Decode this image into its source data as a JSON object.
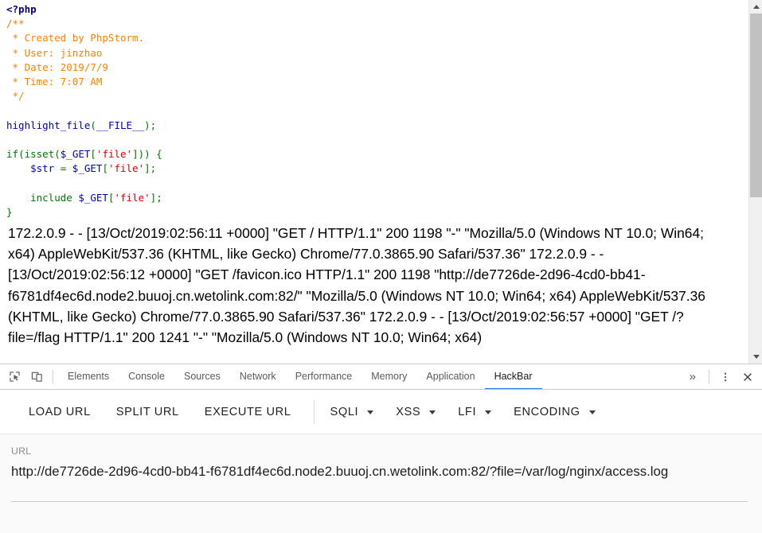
{
  "page": {
    "php_source_lines": [
      [
        {
          "t": "<?php",
          "c": "php-tag"
        }
      ],
      [
        {
          "t": "/**",
          "c": "comment"
        }
      ],
      [
        {
          "t": " * Created by PhpStorm.",
          "c": "comment"
        }
      ],
      [
        {
          "t": " * User: jinzhao",
          "c": "comment"
        }
      ],
      [
        {
          "t": " * Date: 2019/7/9",
          "c": "comment"
        }
      ],
      [
        {
          "t": " * Time: 7:07 AM",
          "c": "comment"
        }
      ],
      [
        {
          "t": " */",
          "c": "comment"
        }
      ],
      [
        {
          "t": "",
          "c": "plain"
        }
      ],
      [
        {
          "t": "highlight_file",
          "c": "fn"
        },
        {
          "t": "(",
          "c": "kw"
        },
        {
          "t": "__FILE__",
          "c": "fn"
        },
        {
          "t": ")",
          "c": "kw"
        },
        {
          "t": ";",
          "c": "punct"
        }
      ],
      [
        {
          "t": "",
          "c": "plain"
        }
      ],
      [
        {
          "t": "if",
          "c": "kw"
        },
        {
          "t": "(",
          "c": "kw"
        },
        {
          "t": "isset",
          "c": "kw"
        },
        {
          "t": "(",
          "c": "kw"
        },
        {
          "t": "$_GET",
          "c": "var"
        },
        {
          "t": "[",
          "c": "kw"
        },
        {
          "t": "'file'",
          "c": "str"
        },
        {
          "t": "]))",
          "c": "kw"
        },
        {
          "t": " {",
          "c": "kw"
        }
      ],
      [
        {
          "t": "    ",
          "c": "plain"
        },
        {
          "t": "$str",
          "c": "var"
        },
        {
          "t": " = ",
          "c": "kw"
        },
        {
          "t": "$_GET",
          "c": "var"
        },
        {
          "t": "[",
          "c": "kw"
        },
        {
          "t": "'file'",
          "c": "str"
        },
        {
          "t": "]",
          "c": "kw"
        },
        {
          "t": ";",
          "c": "punct"
        }
      ],
      [
        {
          "t": "",
          "c": "plain"
        }
      ],
      [
        {
          "t": "    ",
          "c": "plain"
        },
        {
          "t": "include",
          "c": "kw"
        },
        {
          "t": " ",
          "c": "plain"
        },
        {
          "t": "$_GET",
          "c": "var"
        },
        {
          "t": "[",
          "c": "kw"
        },
        {
          "t": "'file'",
          "c": "str"
        },
        {
          "t": "]",
          "c": "kw"
        },
        {
          "t": ";",
          "c": "punct"
        }
      ],
      [
        {
          "t": "}",
          "c": "kw"
        }
      ]
    ],
    "access_log_text": "172.2.0.9 - - [13/Oct/2019:02:56:11 +0000] \"GET / HTTP/1.1\" 200 1198 \"-\" \"Mozilla/5.0 (Windows NT 10.0; Win64; x64) AppleWebKit/537.36 (KHTML, like Gecko) Chrome/77.0.3865.90 Safari/537.36\" 172.2.0.9 - - [13/Oct/2019:02:56:12 +0000] \"GET /favicon.ico HTTP/1.1\" 200 1198 \"http://de7726de-2d96-4cd0-bb41-f6781df4ec6d.node2.buuoj.cn.wetolink.com:82/\" \"Mozilla/5.0 (Windows NT 10.0; Win64; x64) AppleWebKit/537.36 (KHTML, like Gecko) Chrome/77.0.3865.90 Safari/537.36\" 172.2.0.9 - - [13/Oct/2019:02:56:57 +0000] \"GET /?file=/flag HTTP/1.1\" 200 1241 \"-\" \"Mozilla/5.0 (Windows NT 10.0; Win64; x64)"
  },
  "scrollbar": {
    "up_arrow_icon": "triangle-up-icon",
    "down_arrow_icon": "triangle-down-icon",
    "thumb_icon": "scrollbar-thumb"
  },
  "devtools": {
    "inspect_icon": "inspect-element-icon",
    "device_icon": "device-toolbar-icon",
    "tabs": [
      {
        "label": "Elements",
        "active": false
      },
      {
        "label": "Console",
        "active": false
      },
      {
        "label": "Sources",
        "active": false
      },
      {
        "label": "Network",
        "active": false
      },
      {
        "label": "Performance",
        "active": false
      },
      {
        "label": "Memory",
        "active": false
      },
      {
        "label": "Application",
        "active": false
      },
      {
        "label": "HackBar",
        "active": true
      }
    ],
    "more_tabs_label": "»",
    "menu_icon": "kebab-menu-icon",
    "close_icon": "close-icon",
    "active_tab_accent": "#1a73e8"
  },
  "hackbar": {
    "buttons": [
      {
        "label": "LOAD URL"
      },
      {
        "label": "SPLIT URL"
      },
      {
        "label": "EXECUTE URL"
      }
    ],
    "menus": [
      {
        "label": "SQLI"
      },
      {
        "label": "XSS"
      },
      {
        "label": "LFI"
      },
      {
        "label": "ENCODING"
      }
    ],
    "url": {
      "label": "URL",
      "value": "http://de7726de-2d96-4cd0-bb41-f6781df4ec6d.node2.buuoj.cn.wetolink.com:82/?file=/var/log/nginx/access.log",
      "placeholder": "URL"
    }
  }
}
